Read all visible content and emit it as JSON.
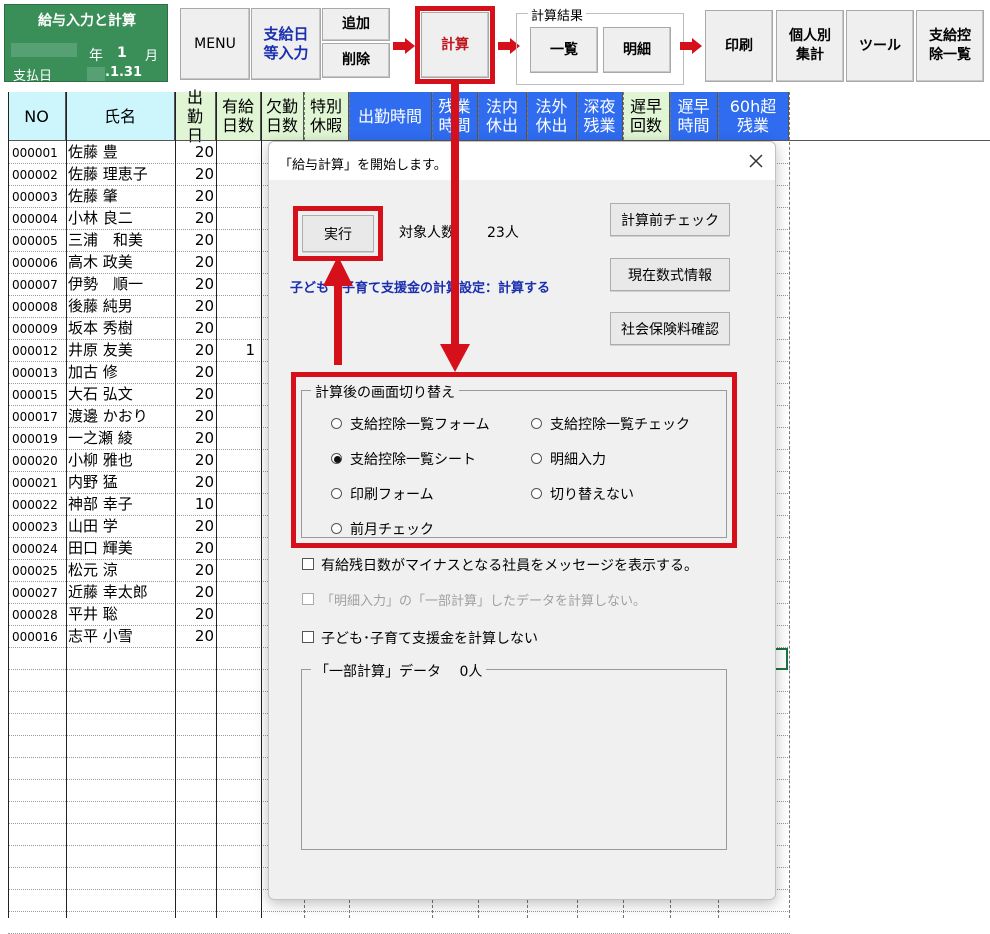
{
  "title_box": {
    "title": "給与入力と計算",
    "period_year_label": "年",
    "period_month_value": "1",
    "period_month_label": "月",
    "pay_date_label": "支払日",
    "pay_date_value": ".1.31"
  },
  "toolbar": {
    "menu": "MENU",
    "payday_input": "支給日\n等入力",
    "add": "追加",
    "delete": "削除",
    "calculate": "計算",
    "result_group_label": "計算結果",
    "list": "一覧",
    "detail": "明細",
    "print": "印刷",
    "individual_total": "個人別\n集計",
    "tools": "ツール",
    "deduction_list": "支給控\n除一覧"
  },
  "sheet": {
    "headers": [
      {
        "label": "NO",
        "bg": "#ccf6fb"
      },
      {
        "label": "氏名",
        "bg": "#ccf6fb"
      },
      {
        "label": "出\n勤\n日",
        "bg": "#dff5d4"
      },
      {
        "label": "有給\n日数",
        "bg": "#dff5d4"
      },
      {
        "label": "欠勤\n日数",
        "bg": "#dff5d4"
      },
      {
        "label": "特別\n休暇",
        "bg": "#dff5d4"
      },
      {
        "label": "出勤時間",
        "bg": "#2f6cf0",
        "fg": "#ffffff"
      },
      {
        "label": "残業\n時間",
        "bg": "#2f6cf0",
        "fg": "#ffffff"
      },
      {
        "label": "法内\n休出",
        "bg": "#2f6cf0",
        "fg": "#ffffff"
      },
      {
        "label": "法外\n休出",
        "bg": "#2f6cf0",
        "fg": "#ffffff"
      },
      {
        "label": "深夜\n残業",
        "bg": "#2f6cf0",
        "fg": "#ffffff"
      },
      {
        "label": "遅早\n回数",
        "bg": "#dff5d4"
      },
      {
        "label": "遅早\n時間",
        "bg": "#2f6cf0",
        "fg": "#ffffff"
      },
      {
        "label": "60h超\n残業",
        "bg": "#2f6cf0",
        "fg": "#ffffff"
      }
    ],
    "rows": [
      {
        "no": "000001",
        "name": "佐藤 豊",
        "days": "20",
        "paid": ""
      },
      {
        "no": "000002",
        "name": "佐藤 理恵子",
        "days": "20",
        "paid": ""
      },
      {
        "no": "000003",
        "name": "佐藤 肇",
        "days": "20",
        "paid": ""
      },
      {
        "no": "000004",
        "name": "小林 良二",
        "days": "20",
        "paid": ""
      },
      {
        "no": "000005",
        "name": "三浦　和美",
        "days": "20",
        "paid": ""
      },
      {
        "no": "000006",
        "name": "高木 政美",
        "days": "20",
        "paid": ""
      },
      {
        "no": "000007",
        "name": "伊勢　順一",
        "days": "20",
        "paid": ""
      },
      {
        "no": "000008",
        "name": "後藤 純男",
        "days": "20",
        "paid": ""
      },
      {
        "no": "000009",
        "name": "坂本 秀樹",
        "days": "20",
        "paid": ""
      },
      {
        "no": "000012",
        "name": "井原 友美",
        "days": "20",
        "paid": "1"
      },
      {
        "no": "000013",
        "name": "加古 修",
        "days": "20",
        "paid": ""
      },
      {
        "no": "000015",
        "name": "大石 弘文",
        "days": "20",
        "paid": ""
      },
      {
        "no": "000017",
        "name": "渡邊 かおり",
        "days": "20",
        "paid": ""
      },
      {
        "no": "000019",
        "name": "一之瀬 綾",
        "days": "20",
        "paid": ""
      },
      {
        "no": "000020",
        "name": "小柳 雅也",
        "days": "20",
        "paid": ""
      },
      {
        "no": "000021",
        "name": "内野 猛",
        "days": "20",
        "paid": ""
      },
      {
        "no": "000022",
        "name": "神部 幸子",
        "days": "10",
        "paid": ""
      },
      {
        "no": "000023",
        "name": "山田 学",
        "days": "20",
        "paid": ""
      },
      {
        "no": "000024",
        "name": "田口 輝美",
        "days": "20",
        "paid": ""
      },
      {
        "no": "000025",
        "name": "松元 涼",
        "days": "20",
        "paid": ""
      },
      {
        "no": "000027",
        "name": "近藤 幸太郎",
        "days": "20",
        "paid": ""
      },
      {
        "no": "000028",
        "name": "平井 聡",
        "days": "20",
        "paid": ""
      },
      {
        "no": "000016",
        "name": "志平 小雪",
        "days": "20",
        "paid": ""
      }
    ]
  },
  "dialog": {
    "title": "「給与計算」を開始します。",
    "execute": "実行",
    "target_label": "対象人数",
    "target_count": "23人",
    "child_support_setting": "子ども・子育て支援金の計算設定：計算する",
    "pre_check": "計算前チェック",
    "formula_info": "現在数式情報",
    "insurance_check": "社会保険料確認",
    "switch_group_label": "計算後の画面切り替え",
    "options": [
      {
        "label": "支給控除一覧フォーム",
        "selected": false
      },
      {
        "label": "支給控除一覧チェック",
        "selected": false
      },
      {
        "label": "支給控除一覧シート",
        "selected": true
      },
      {
        "label": "明細入力",
        "selected": false
      },
      {
        "label": "印刷フォーム",
        "selected": false
      },
      {
        "label": "切り替えない",
        "selected": false
      },
      {
        "label": "前月チェック",
        "selected": false
      }
    ],
    "check_negative_leave": "有給残日数がマイナスとなる社員をメッセージを表示する。",
    "check_partial": "「明細入力」の「一部計算」したデータを計算しない。",
    "check_child_support": "子ども･子育て支援金を計算しない",
    "partial_group_label": "「一部計算」データ　 0人"
  },
  "colors": {
    "highlight_red": "#d6101a",
    "title_green": "#3a8f58",
    "blue_text": "#1a2fb0",
    "header_blue": "#2f6cf0"
  }
}
